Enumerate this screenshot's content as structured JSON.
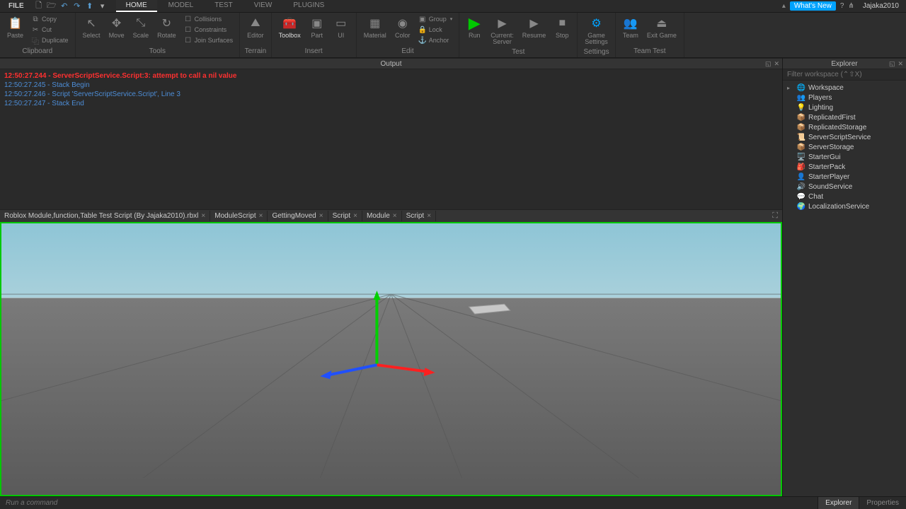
{
  "menu": {
    "file": "FILE",
    "tabs": [
      "HOME",
      "MODEL",
      "TEST",
      "VIEW",
      "PLUGINS"
    ],
    "active_tab": 0,
    "whatsnew": "What's New",
    "user": "Jajaka2010"
  },
  "ribbon": {
    "clipboard": {
      "label": "Clipboard",
      "paste": "Paste",
      "copy": "Copy",
      "cut": "Cut",
      "duplicate": "Duplicate"
    },
    "tools": {
      "label": "Tools",
      "select": "Select",
      "move": "Move",
      "scale": "Scale",
      "rotate": "Rotate",
      "collisions": "Collisions",
      "constraints": "Constraints",
      "join": "Join Surfaces"
    },
    "terrain": {
      "label": "Terrain",
      "editor": "Editor"
    },
    "insert": {
      "label": "Insert",
      "toolbox": "Toolbox",
      "part": "Part",
      "ui": "UI"
    },
    "edit": {
      "label": "Edit",
      "material": "Material",
      "color": "Color",
      "group": "Group",
      "lock": "Lock",
      "anchor": "Anchor"
    },
    "test": {
      "label": "Test",
      "run": "Run",
      "current": "Current:",
      "server": "Server",
      "resume": "Resume",
      "stop": "Stop"
    },
    "settings": {
      "label": "Settings",
      "btn": "Game\nSettings"
    },
    "teamtest": {
      "label": "Team Test",
      "team": "Team",
      "exit": "Exit Game"
    }
  },
  "output": {
    "title": "Output",
    "lines": [
      {
        "text": "12:50:27.244 - ServerScriptService.Script:3: attempt to call a nil value",
        "cls": "err"
      },
      {
        "text": "12:50:27.245 - Stack Begin",
        "cls": "trace"
      },
      {
        "text": "12:50:27.246 - Script 'ServerScriptService.Script', Line 3",
        "cls": "trace"
      },
      {
        "text": "12:50:27.247 - Stack End",
        "cls": "trace"
      }
    ]
  },
  "doctabs": [
    {
      "label": "Roblox Module,function,Table Test Script (By Jajaka2010).rbxl"
    },
    {
      "label": "ModuleScript"
    },
    {
      "label": "GettingMoved"
    },
    {
      "label": "Script"
    },
    {
      "label": "Module"
    },
    {
      "label": "Script"
    }
  ],
  "explorer": {
    "title": "Explorer",
    "filter_placeholder": "Filter workspace (⌃⇧X)",
    "items": [
      {
        "name": "Workspace",
        "icon": "🌐",
        "color": "#4fbf4f",
        "expandable": true
      },
      {
        "name": "Players",
        "icon": "👥",
        "color": "#6fb0e8"
      },
      {
        "name": "Lighting",
        "icon": "💡",
        "color": "#f2d24b"
      },
      {
        "name": "ReplicatedFirst",
        "icon": "📦",
        "color": "#c8962f"
      },
      {
        "name": "ReplicatedStorage",
        "icon": "📦",
        "color": "#c8962f"
      },
      {
        "name": "ServerScriptService",
        "icon": "📜",
        "color": "#5a6aa8"
      },
      {
        "name": "ServerStorage",
        "icon": "📦",
        "color": "#c8962f"
      },
      {
        "name": "StarterGui",
        "icon": "🖥️",
        "color": "#d98a3c"
      },
      {
        "name": "StarterPack",
        "icon": "🎒",
        "color": "#d98a3c"
      },
      {
        "name": "StarterPlayer",
        "icon": "👤",
        "color": "#d98a3c"
      },
      {
        "name": "SoundService",
        "icon": "🔊",
        "color": "#888888"
      },
      {
        "name": "Chat",
        "icon": "💬",
        "color": "#6fb0e8"
      },
      {
        "name": "LocalizationService",
        "icon": "🌍",
        "color": "#6fb0e8"
      }
    ]
  },
  "bottom": {
    "cmd_placeholder": "Run a command",
    "tabs": [
      "Explorer",
      "Properties"
    ],
    "active": 0
  },
  "colors": {
    "accent": "#00a2ff",
    "run_green": "#00c800",
    "error": "#ff3030",
    "trace": "#4d8dd6"
  }
}
